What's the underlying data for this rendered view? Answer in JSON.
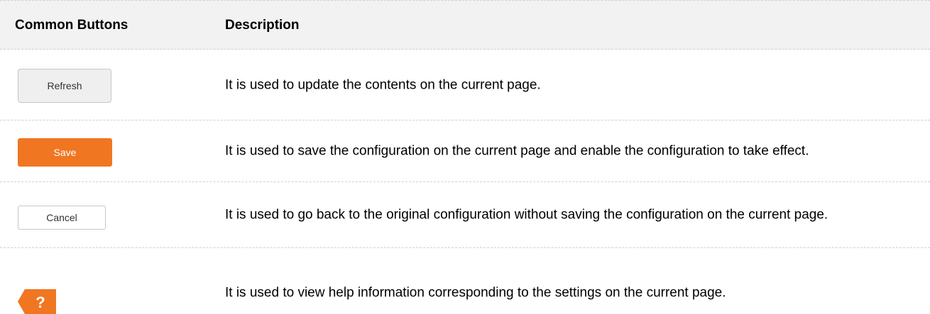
{
  "table": {
    "headers": [
      "Common Buttons",
      "Description"
    ],
    "rows": [
      {
        "button_label": "Refresh",
        "description": "It is used to update the contents on the current page."
      },
      {
        "button_label": "Save",
        "description": "It is used to save the configuration on the current page and enable the configuration to take effect."
      },
      {
        "button_label": "Cancel",
        "description": "It is used to go back to the original configuration without saving the configuration on the current page."
      },
      {
        "button_label": "?",
        "icon": "help-tab-icon",
        "description": "It is used to view help information corresponding to the settings on the current page."
      }
    ]
  },
  "colors": {
    "accent": "#f07622",
    "header_bg": "#f2f2f2"
  }
}
